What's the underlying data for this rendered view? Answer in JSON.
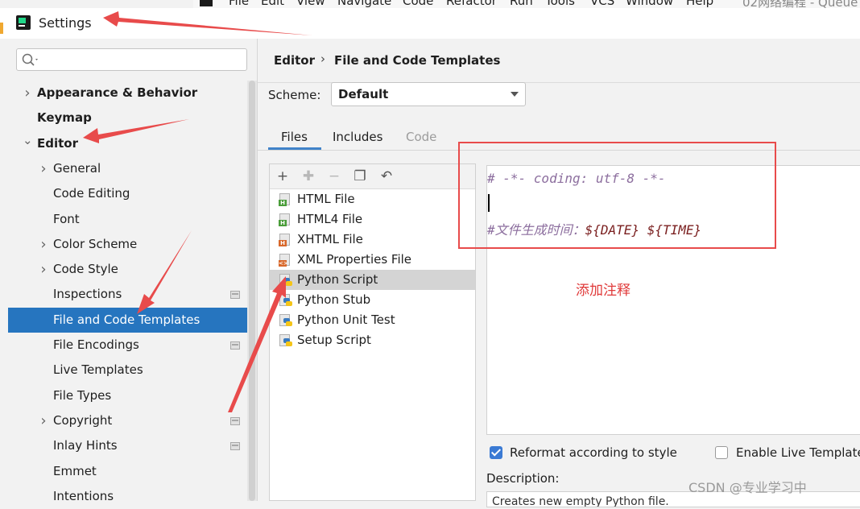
{
  "background_menubar": {
    "items": [
      "File",
      "Edit",
      "View",
      "Navigate",
      "Code",
      "Refactor",
      "Run",
      "Tools",
      "VCS",
      "Window",
      "Help"
    ],
    "project_title": "02网络编程 - Queue"
  },
  "window": {
    "title": "Settings"
  },
  "search": {
    "placeholder": ""
  },
  "sidebar": {
    "items": [
      {
        "label": "Appearance & Behavior",
        "bold": true,
        "expandable": true,
        "expanded": false
      },
      {
        "label": "Keymap",
        "bold": true,
        "expandable": false
      },
      {
        "label": "Editor",
        "bold": true,
        "expandable": true,
        "expanded": true
      },
      {
        "label": "General",
        "expandable": true,
        "expanded": false
      },
      {
        "label": "Code Editing"
      },
      {
        "label": "Font"
      },
      {
        "label": "Color Scheme",
        "expandable": true,
        "expanded": false
      },
      {
        "label": "Code Style",
        "expandable": true,
        "expanded": false
      },
      {
        "label": "Inspections",
        "project_icon": true
      },
      {
        "label": "File and Code Templates",
        "selected": true
      },
      {
        "label": "File Encodings",
        "project_icon": true
      },
      {
        "label": "Live Templates"
      },
      {
        "label": "File Types"
      },
      {
        "label": "Copyright",
        "expandable": true,
        "expanded": false,
        "project_icon": true
      },
      {
        "label": "Inlay Hints",
        "project_icon": true
      },
      {
        "label": "Emmet"
      },
      {
        "label": "Intentions"
      }
    ]
  },
  "breadcrumb": {
    "parent": "Editor",
    "separator": "›",
    "current": "File and Code Templates"
  },
  "scheme": {
    "label": "Scheme:",
    "value": "Default"
  },
  "tabs": {
    "files": "Files",
    "includes": "Includes",
    "code": "Code"
  },
  "toolbar": {
    "add": "+",
    "copy_disabled": "✚",
    "remove": "−",
    "duplicate": "❐",
    "reset": "↶"
  },
  "templates": [
    {
      "label": "HTML File",
      "icon": "html-file-icon",
      "badge": "H",
      "badge_color": "#4a9d3a"
    },
    {
      "label": "HTML4 File",
      "icon": "html-file-icon",
      "badge": "H",
      "badge_color": "#4a9d3a"
    },
    {
      "label": "XHTML File",
      "icon": "xhtml-file-icon",
      "badge": "H",
      "badge_color": "#d8672a"
    },
    {
      "label": "XML Properties File",
      "icon": "xml-file-icon",
      "badge": "<>",
      "badge_color": "#d8672a"
    },
    {
      "label": "Python Script",
      "icon": "python-file-icon",
      "selected": true
    },
    {
      "label": "Python Stub",
      "icon": "python-file-icon"
    },
    {
      "label": "Python Unit Test",
      "icon": "python-file-icon"
    },
    {
      "label": "Setup Script",
      "icon": "python-file-icon"
    }
  ],
  "editor": {
    "line1": "# -*- coding: utf-8 -*-",
    "line3_comment": "#文件生成时间：",
    "line3_date": "${DATE}",
    "line3_space": " ",
    "line3_time": "${TIME}"
  },
  "annotation": {
    "note": "添加注释"
  },
  "options": {
    "reformat_label": "Reformat according to style",
    "reformat_checked": true,
    "live_templates_label": "Enable Live Templates",
    "live_templates_checked": false
  },
  "description": {
    "label": "Description:",
    "text": "Creates new empty Python file."
  },
  "watermark": "CSDN @专业学习中",
  "colors": {
    "selection": "#2675bf",
    "annotation_red": "#e84b4b",
    "accent": "#3a7ad4"
  }
}
